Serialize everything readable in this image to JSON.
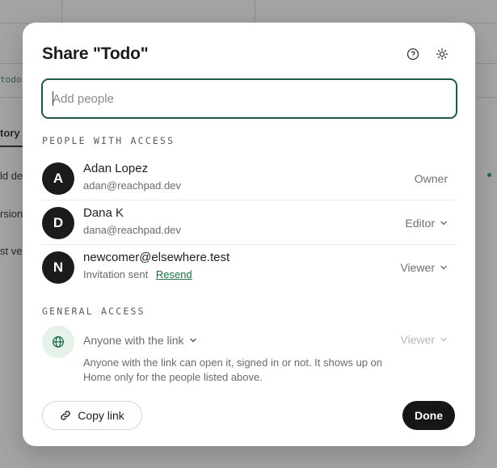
{
  "background": {
    "file_chip": "todo.",
    "tab_label": "tory",
    "row1": "ld de",
    "row2": "rsion",
    "row3": "st ve"
  },
  "dialog": {
    "title": "Share \"Todo\"",
    "help_icon": "help-circle-icon",
    "theme_icon": "sun-icon",
    "add_people_placeholder": "Add people",
    "add_people_value": "",
    "people_section_label": "PEOPLE WITH ACCESS",
    "people": [
      {
        "initial": "A",
        "name": "Adan Lopez",
        "email": "adan@reachpad.dev",
        "role": "Owner",
        "has_dropdown": false
      },
      {
        "initial": "D",
        "name": "Dana K",
        "email": "dana@reachpad.dev",
        "role": "Editor",
        "has_dropdown": true
      },
      {
        "initial": "N",
        "name": "newcomer@elsewhere.test",
        "status": "Invitation sent",
        "action": "Resend",
        "role": "Viewer",
        "has_dropdown": true
      }
    ],
    "general_section_label": "GENERAL ACCESS",
    "general_access": {
      "icon": "globe-icon",
      "selected": "Anyone with the link",
      "role": "Viewer",
      "description": "Anyone with the link can open it, signed in or not. It shows up on Home only for the people listed above."
    },
    "copy_link_label": "Copy link",
    "done_label": "Done"
  },
  "colors": {
    "accent": "#1f5a3f",
    "link": "#1d6b47",
    "globe_bg": "#e4f2ea",
    "primary_button": "#161616"
  }
}
